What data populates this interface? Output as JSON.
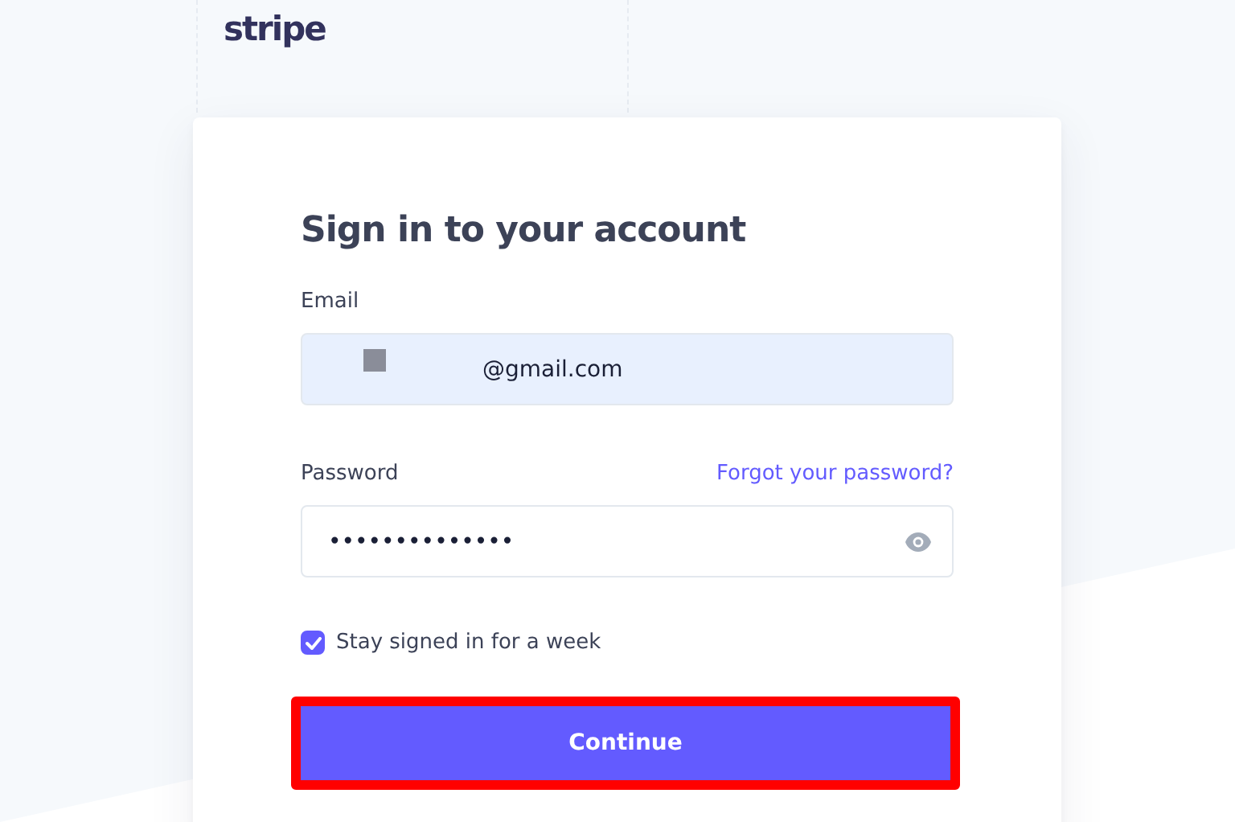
{
  "logo": {
    "text": "stripe"
  },
  "card": {
    "title": "Sign in to your account"
  },
  "email": {
    "label": "Email",
    "value": "@gmail.com",
    "redacted": true
  },
  "password": {
    "label": "Password",
    "forgot_link": "Forgot your password?",
    "value": "••••••••••••••",
    "masked": true
  },
  "remember": {
    "label": "Stay signed in for a week",
    "checked": true
  },
  "submit": {
    "label": "Continue",
    "highlighted": true
  }
}
